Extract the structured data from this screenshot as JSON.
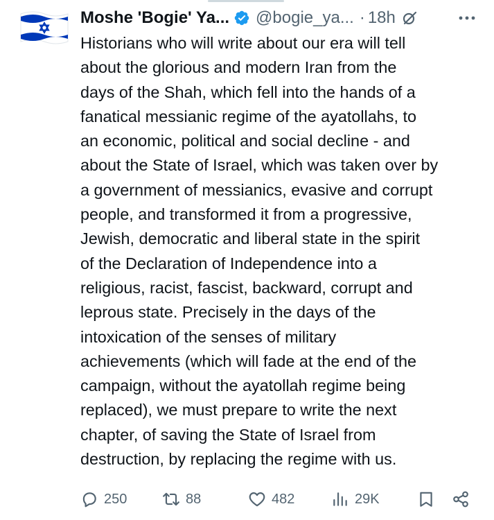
{
  "author": {
    "name": "Moshe 'Bogie' Ya...",
    "handle": "@bogie_ya...",
    "separator": "·",
    "time": "18h",
    "avatar_icon": "israel-flag",
    "verified_color": "#1d9bf0"
  },
  "tweet": {
    "lines": [
      "Historians who will write about our era will tell",
      "about the glorious and modern Iran from the",
      "days of the Shah, which fell into the hands of a",
      "fanatical messianic regime of the ayatollahs, to",
      "an economic, political and social decline - and",
      "about the State of Israel, which was taken over by",
      "a government of messianics, evasive and corrupt",
      "people, and transformed it from a progressive,",
      "Jewish, democratic and liberal state in the spirit",
      "of the Declaration of Independence into a",
      "religious, racist, fascist, backward, corrupt and",
      "leprous state. Precisely in the days of the",
      "intoxication of the senses of military",
      "achievements (which will fade at the end of the",
      "campaign, without the ayatollah regime being",
      "replaced), we must prepare to write the next",
      "chapter, of saving the State of Israel from",
      "destruction, by replacing the regime with us."
    ]
  },
  "actions": {
    "replies": "250",
    "reposts": "88",
    "likes": "482",
    "views": "29K"
  },
  "colors": {
    "text": "#0f1419",
    "secondary": "#536471",
    "flag_blue": "#0038b8"
  }
}
